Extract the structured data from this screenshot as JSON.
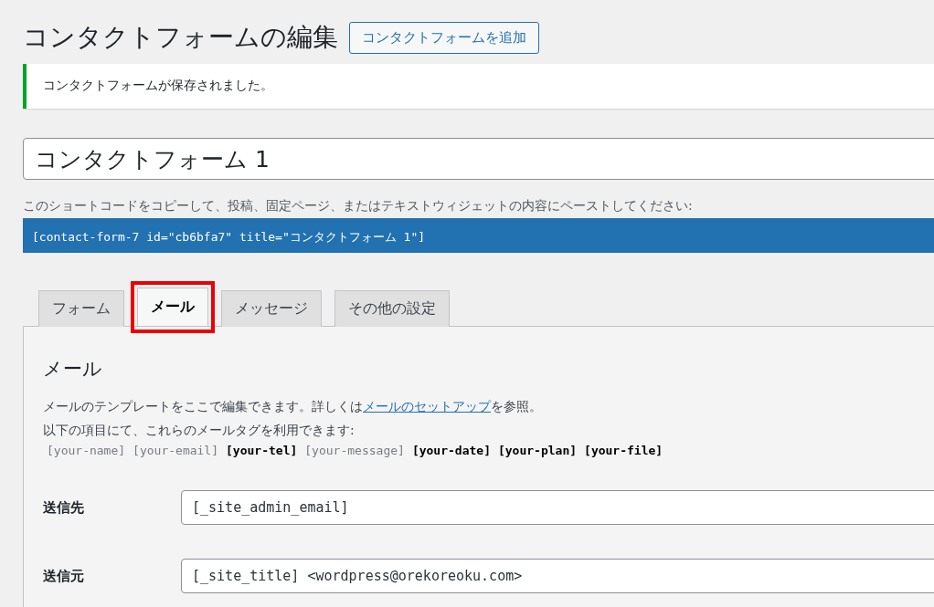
{
  "page_title": "コンタクトフォームの編集",
  "add_button": "コンタクトフォームを追加",
  "notice": "コンタクトフォームが保存されました。",
  "form_title": {
    "value": "コンタクトフォーム 1"
  },
  "shortcode_hint": "このショートコードをコピーして、投稿、固定ページ、またはテキストウィジェットの内容にペーストしてください:",
  "shortcode": "[contact-form-7 id=\"cb6bfa7\" title=\"コンタクトフォーム 1\"]",
  "tabs": [
    {
      "label": "フォーム",
      "selected": false,
      "highlighted": false
    },
    {
      "label": "メール",
      "selected": true,
      "highlighted": true
    },
    {
      "label": "メッセージ",
      "selected": false,
      "highlighted": false
    },
    {
      "label": "その他の設定",
      "selected": false,
      "highlighted": false
    }
  ],
  "panel": {
    "heading": "メール",
    "description": {
      "before": "メールのテンプレートをここで編集できます。詳しくは",
      "link": "メールのセットアップ",
      "after": "を参照。"
    },
    "tags_intro": "以下の項目にて、これらのメールタグを利用できます:",
    "mail_tags": [
      {
        "text": "[your-name]",
        "used": false
      },
      {
        "text": "[your-email]",
        "used": false
      },
      {
        "text": "[your-tel]",
        "used": true
      },
      {
        "text": "[your-message]",
        "used": false
      },
      {
        "text": "[your-date]",
        "used": true
      },
      {
        "text": "[your-plan]",
        "used": true
      },
      {
        "text": "[your-file]",
        "used": true
      }
    ],
    "fields": [
      {
        "label": "送信先",
        "value": "[_site_admin_email]"
      },
      {
        "label": "送信元",
        "value": "[_site_title] <wordpress@orekoreoku.com>"
      }
    ]
  }
}
